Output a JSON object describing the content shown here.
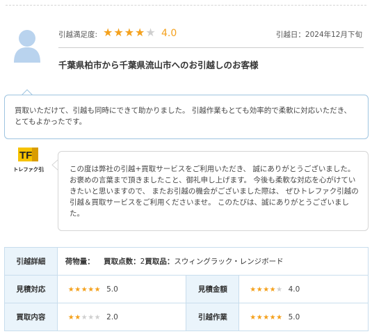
{
  "header": {
    "satisfaction_label": "引越満足度:",
    "rating_value": "4.0",
    "rating_stars": "★★★★",
    "rating_stars_off": "★",
    "date": "引越日：2024年12月下旬",
    "customer_title": "千葉県柏市から千葉県流山市へのお引越しのお客様"
  },
  "comment": {
    "text": "買取いただけて、引越も同時にできて助かりました。 引越作業もとても効率的で柔軟に対応いただき、とてもよかったです。"
  },
  "company": {
    "logo_letters": "TF",
    "logo_text": "トレファク引越",
    "reply": "この度は弊社の引越+買取サービスをご利用いただき、 誠にありがとうございました。 お褒めの言葉まで頂きましたこと、御礼申し上げます。 今後も柔軟な対応を心がけていきたいと思いますので、 またお引越の機会がございました際は、 ぜひトレファク引越の引越＆買取サービスをご利用くださいませ。 このたびは、誠にありがとうございました。"
  },
  "details": {
    "row1": {
      "label": "引越詳細",
      "volume_label": "荷物量：",
      "count_label": "買取点数：",
      "count_value": "2",
      "items_label": "買取品：",
      "items_value": "スウィングラック・レンジボード"
    },
    "estimate_response": {
      "label": "見積対応",
      "stars_on": "★★★★★",
      "stars_off": "",
      "value": "5.0"
    },
    "estimate_price": {
      "label": "見積金額",
      "stars_on": "★★★★",
      "stars_off": "★",
      "value": "4.0"
    },
    "purchase_content": {
      "label": "買取内容",
      "stars_on": "★★",
      "stars_off": "★★★",
      "value": "2.0"
    },
    "moving_work": {
      "label": "引越作業",
      "stars_on": "★★★★★",
      "stars_off": "",
      "value": "5.0"
    }
  },
  "colors": {
    "star": "#f4a11d",
    "star_off": "#cfcfcf",
    "table_header": "#eaf4fb",
    "box_border": "#9ec4e0"
  }
}
